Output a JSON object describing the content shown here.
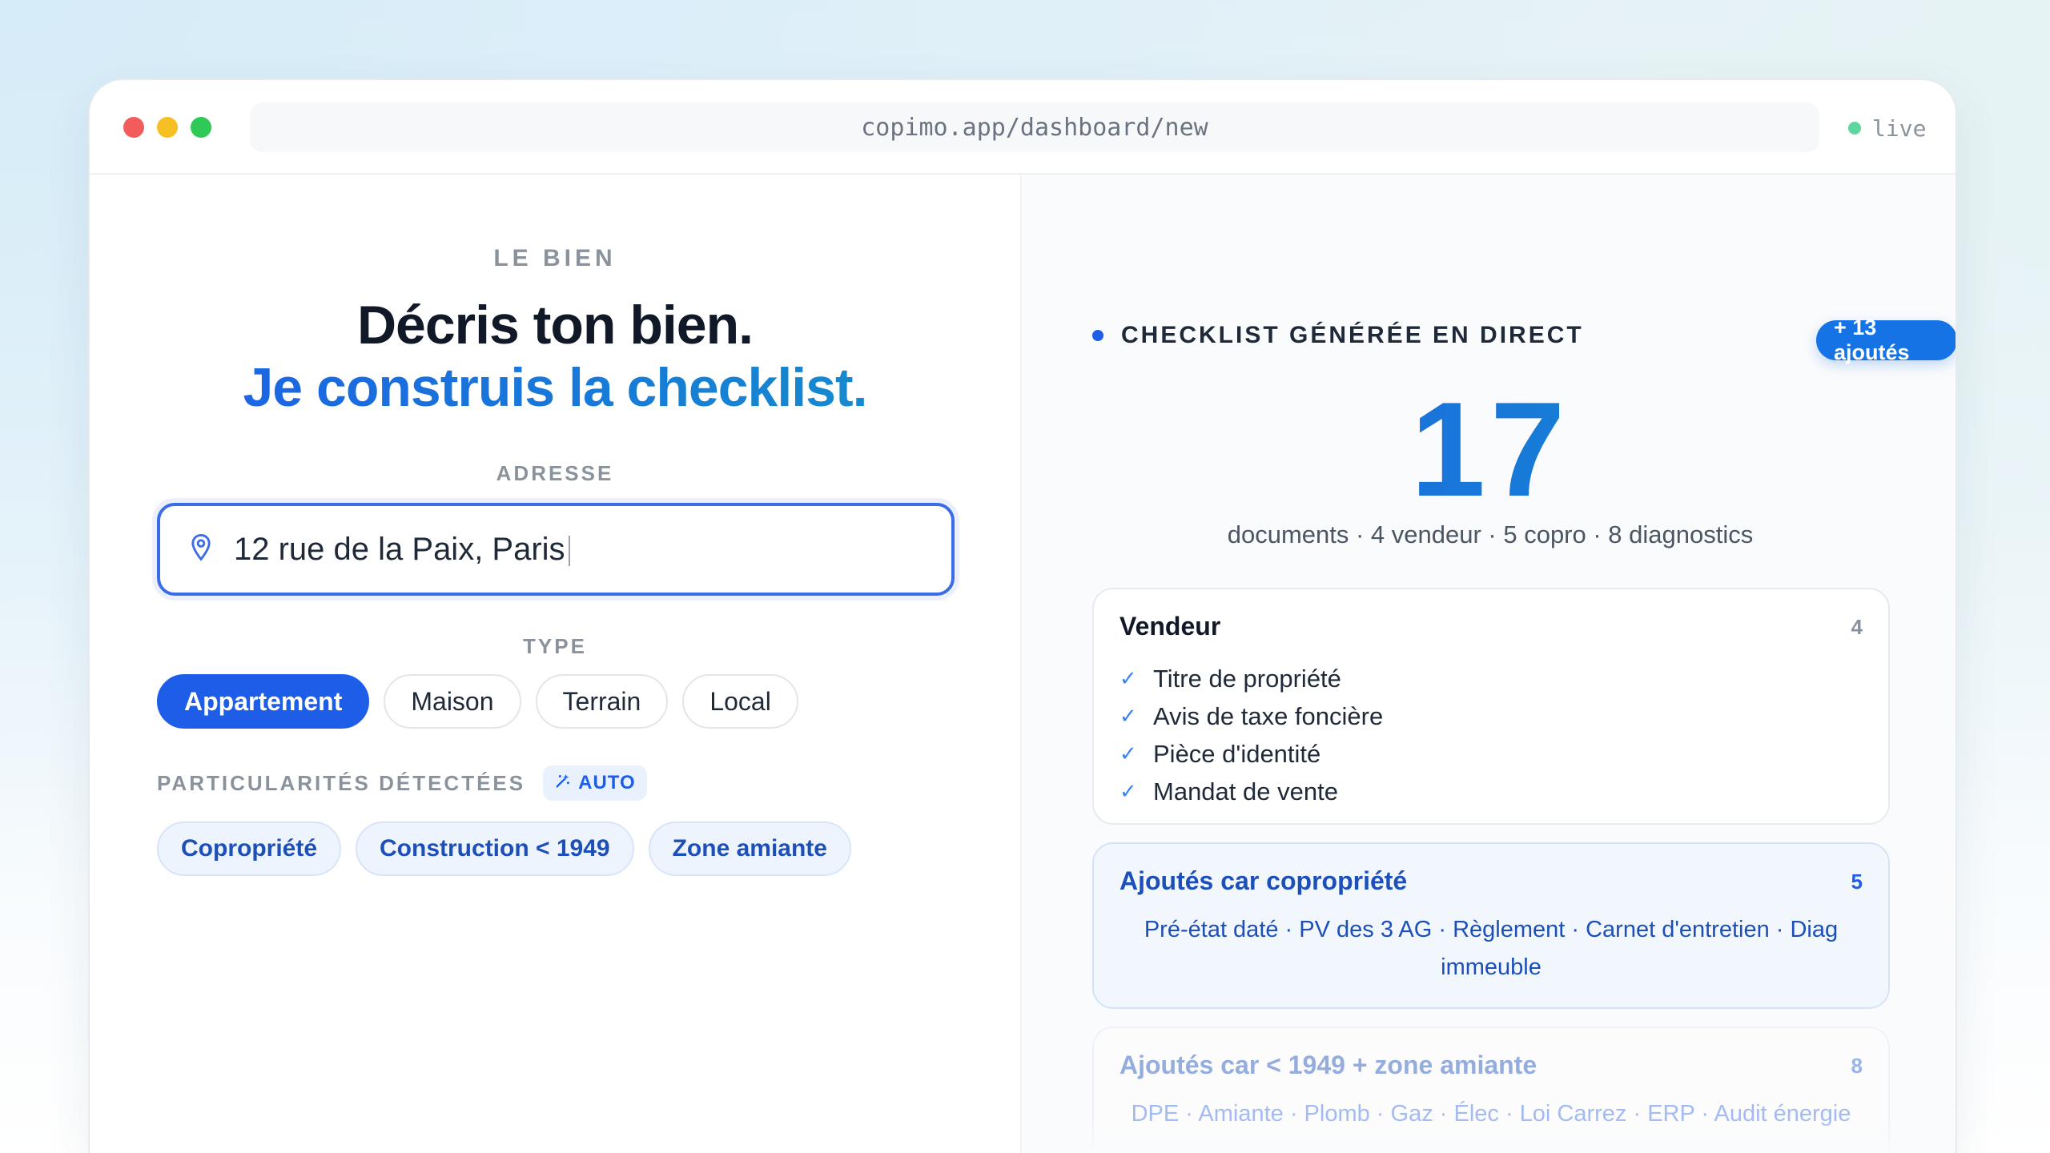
{
  "window": {
    "url": "copimo.app/dashboard/new",
    "status": "live"
  },
  "left": {
    "eyebrow": "LE BIEN",
    "headline_line1": "Décris ton bien.",
    "headline_line2": "Je construis la checklist.",
    "address_label": "ADRESSE",
    "address_value": "12 rue de la Paix, Paris",
    "type_label": "TYPE",
    "types": [
      {
        "label": "Appartement",
        "active": true
      },
      {
        "label": "Maison",
        "active": false
      },
      {
        "label": "Terrain",
        "active": false
      },
      {
        "label": "Local",
        "active": false
      }
    ],
    "particularites_label": "PARTICULARITÉS DÉTECTÉES",
    "auto_label": "AUTO",
    "tags": [
      "Copropriété",
      "Construction < 1949",
      "Zone amiante"
    ]
  },
  "right": {
    "title": "CHECKLIST GÉNÉRÉE EN DIRECT",
    "added_badge": "+ 13 ajoutés",
    "total": "17",
    "summary": "documents · 4 vendeur · 5 copro · 8 diagnostics",
    "vendeur": {
      "title": "Vendeur",
      "count": "4",
      "items": [
        "Titre de propriété",
        "Avis de taxe foncière",
        "Pièce d'identité",
        "Mandat de vente"
      ]
    },
    "copro": {
      "title": "Ajoutés car copropriété",
      "count": "5",
      "items": "Pré-état daté · PV des 3 AG · Règlement · Carnet d'entretien · Diag immeuble"
    },
    "amiante": {
      "title": "Ajoutés car < 1949 + zone amiante",
      "count": "8",
      "items": "DPE · Amiante · Plomb · Gaz · Élec · Loi Carrez · ERP · Audit énergie"
    }
  },
  "colors": {
    "accent": "#1d5de8",
    "accent_secondary": "#1493c9",
    "live_dot": "#5fd6a2"
  }
}
